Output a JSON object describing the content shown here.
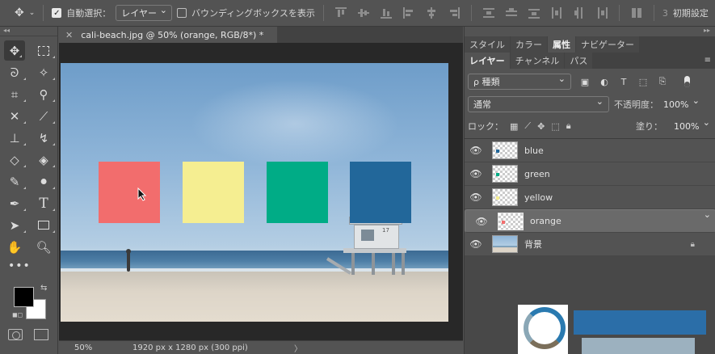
{
  "options_bar": {
    "auto_select_label": "自動選択：",
    "auto_select_target": "レイヤー",
    "show_transform_label": "バウンディングボックスを表示",
    "preset": "初期設定",
    "preset_prefix": "3"
  },
  "document": {
    "tab_title": "cali-beach.jpg @ 50% (orange, RGB/8*) *",
    "swatches": [
      {
        "name": "red",
        "color": "#f26d6d"
      },
      {
        "name": "yellow",
        "color": "#f5ee91"
      },
      {
        "name": "green",
        "color": "#00ac86"
      },
      {
        "name": "blue",
        "color": "#22679a"
      }
    ],
    "tower_sign": "17"
  },
  "status": {
    "zoom": "50%",
    "dimensions": "1920 px x 1280 px (300 ppi)",
    "more": "〉"
  },
  "panel": {
    "top_tabs": [
      "スタイル",
      "カラー",
      "属性",
      "ナビゲーター"
    ],
    "top_active": 2,
    "layer_tabs": [
      "レイヤー",
      "チャンネル",
      "パス"
    ],
    "layer_active": 0,
    "filter_kind": "ρ 種類",
    "blend_mode": "通常",
    "opacity_label": "不透明度：",
    "opacity_value": "100%",
    "lock_label": "ロック：",
    "fill_label": "塗り：",
    "fill_value": "100%",
    "layers": [
      {
        "name": "blue",
        "color": "#22679a",
        "selected": false
      },
      {
        "name": "green",
        "color": "#00ac86",
        "selected": false
      },
      {
        "name": "yellow",
        "color": "#f5ee91",
        "selected": false
      },
      {
        "name": "orange",
        "color": "#f26d6d",
        "selected": true
      },
      {
        "name": "背景",
        "color": "",
        "selected": false,
        "locked": true
      }
    ]
  },
  "colors": {
    "foreground": "#000000",
    "background": "#ffffff"
  }
}
